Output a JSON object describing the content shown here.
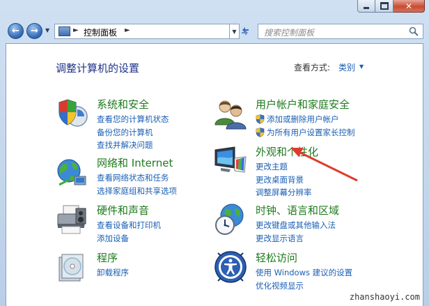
{
  "window": {
    "controls": {
      "minimize": "–",
      "maximize": "□",
      "close": "✕"
    }
  },
  "address_bar": {
    "icon": "control-panel-icon",
    "path": [
      "控制面板"
    ],
    "separator": "►"
  },
  "search": {
    "placeholder": "搜索控制面板"
  },
  "header": {
    "title": "调整计算机的设置",
    "view_by_label": "查看方式:",
    "view_by_value": "类别"
  },
  "categories": [
    {
      "title": "系统和安全",
      "icon": "shield-system-icon",
      "links": [
        "查看您的计算机状态",
        "备份您的计算机",
        "查找并解决问题"
      ]
    },
    {
      "title": "网络和 Internet",
      "icon": "network-globe-icon",
      "links": [
        "查看网络状态和任务",
        "选择家庭组和共享选项"
      ]
    },
    {
      "title": "硬件和声音",
      "icon": "printer-hardware-icon",
      "links": [
        "查看设备和打印机",
        "添加设备"
      ]
    },
    {
      "title": "程序",
      "icon": "programs-disc-icon",
      "links": [
        "卸载程序"
      ]
    },
    {
      "title": "用户帐户和家庭安全",
      "icon": "users-icon",
      "links": [
        "添加或删除用户帐户",
        "为所有用户设置家长控制"
      ],
      "link_shields": [
        true,
        true
      ]
    },
    {
      "title": "外观和个性化",
      "icon": "monitor-palette-icon",
      "links": [
        "更改主题",
        "更改桌面背景",
        "调整屏幕分辨率"
      ]
    },
    {
      "title": "时钟、语言和区域",
      "icon": "clock-globe-icon",
      "links": [
        "更改键盘或其他输入法",
        "更改显示语言"
      ]
    },
    {
      "title": "轻松访问",
      "icon": "ease-of-access-icon",
      "links": [
        "使用 Windows 建议的设置",
        "优化视频显示"
      ]
    }
  ],
  "watermark": "zhanshaoyi.com",
  "colors": {
    "category_title": "#1e7a1e",
    "link": "#1a5fb4",
    "page_title": "#1e3287",
    "annotation_arrow": "#e03a2c"
  }
}
